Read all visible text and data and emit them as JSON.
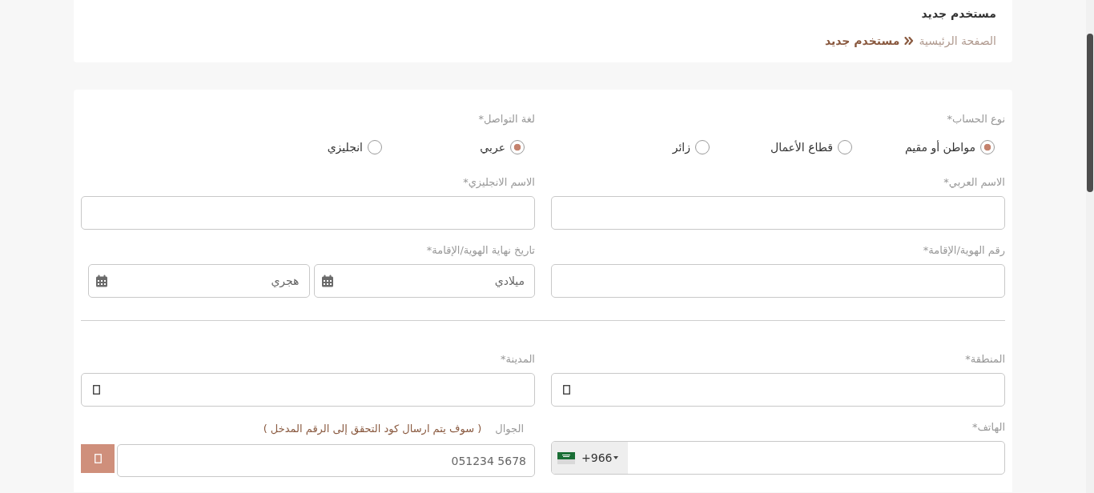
{
  "header": {
    "title": "مستخدم جديد",
    "breadcrumb": [
      {
        "label": "الصفحة الرئيسية",
        "current": false
      },
      {
        "label": "مستخدم جديد",
        "current": true
      }
    ]
  },
  "form": {
    "sections": [
      {
        "rows": [
          [
            {
              "kind": "radio",
              "label": "نوع الحساب*",
              "options": [
                {
                  "label": "مواطن أو مقيم",
                  "selected": true
                },
                {
                  "label": "قطاع الأعمال",
                  "selected": false
                },
                {
                  "label": "زائر",
                  "selected": false
                }
              ]
            },
            {
              "kind": "radio",
              "label": "لغة التواصل*",
              "options": [
                {
                  "label": "عربي",
                  "selected": true
                },
                {
                  "label": "انجليزي",
                  "selected": false
                }
              ]
            }
          ],
          [
            {
              "kind": "text",
              "label": "الاسم العربي*"
            },
            {
              "kind": "text",
              "label": "الاسم الانجليزي*"
            }
          ],
          [
            {
              "kind": "text",
              "label": "رقم الهوية/الإقامة*"
            },
            {
              "kind": "dates",
              "label": "تاريخ نهاية الهوية/الإقامة*",
              "inputs": [
                {
                  "placeholder": "ميلادي"
                },
                {
                  "placeholder": "هجري"
                }
              ]
            }
          ]
        ]
      },
      {
        "rows": [
          [
            {
              "kind": "select",
              "label": "المنطقة*"
            },
            {
              "kind": "select",
              "label": "المدينة*"
            }
          ],
          [
            {
              "kind": "phone",
              "label": "الهاتف*",
              "country_code": "+966"
            },
            {
              "kind": "mobile",
              "label": "الجوال",
              "hint": "( سوف يتم ارسال كود التحقق إلى الرقم المدخل )",
              "placeholder": "051234 5678"
            }
          ]
        ]
      }
    ]
  }
}
